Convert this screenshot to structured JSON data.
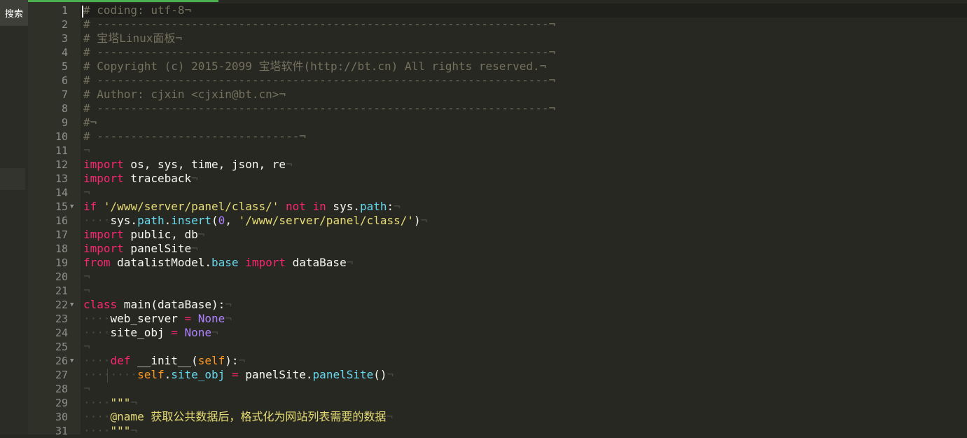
{
  "sidebar": {
    "search_label": "搜索"
  },
  "editor": {
    "lines": [
      {
        "n": "1",
        "fold": false,
        "tokens": [
          {
            "t": "# coding: utf-8¬",
            "c": "comment"
          }
        ]
      },
      {
        "n": "2",
        "fold": false,
        "tokens": [
          {
            "t": "# -------------------------------------------------------------------¬",
            "c": "comment"
          }
        ]
      },
      {
        "n": "3",
        "fold": false,
        "tokens": [
          {
            "t": "# 宝塔Linux面板¬",
            "c": "comment"
          }
        ]
      },
      {
        "n": "4",
        "fold": false,
        "tokens": [
          {
            "t": "# -------------------------------------------------------------------¬",
            "c": "comment"
          }
        ]
      },
      {
        "n": "5",
        "fold": false,
        "tokens": [
          {
            "t": "# Copyright (c) 2015-2099 宝塔软件(http://bt.cn) All rights reserved.¬",
            "c": "comment"
          }
        ]
      },
      {
        "n": "6",
        "fold": false,
        "tokens": [
          {
            "t": "# -------------------------------------------------------------------¬",
            "c": "comment"
          }
        ]
      },
      {
        "n": "7",
        "fold": false,
        "tokens": [
          {
            "t": "# Author: cjxin <cjxin@bt.cn>¬",
            "c": "comment"
          }
        ]
      },
      {
        "n": "8",
        "fold": false,
        "tokens": [
          {
            "t": "# -------------------------------------------------------------------¬",
            "c": "comment"
          }
        ]
      },
      {
        "n": "9",
        "fold": false,
        "tokens": [
          {
            "t": "#¬",
            "c": "comment"
          }
        ]
      },
      {
        "n": "10",
        "fold": false,
        "tokens": [
          {
            "t": "# ------------------------------¬",
            "c": "comment"
          }
        ]
      },
      {
        "n": "11",
        "fold": false,
        "tokens": [
          {
            "t": "¬",
            "c": "ws"
          }
        ]
      },
      {
        "n": "12",
        "fold": false,
        "tokens": [
          {
            "t": "import",
            "c": "kw"
          },
          {
            "t": " os, sys, time, json, re",
            "c": ""
          },
          {
            "t": "¬",
            "c": "ws"
          }
        ]
      },
      {
        "n": "13",
        "fold": false,
        "tokens": [
          {
            "t": "import",
            "c": "kw"
          },
          {
            "t": " traceback",
            "c": ""
          },
          {
            "t": "¬",
            "c": "ws"
          }
        ]
      },
      {
        "n": "14",
        "fold": false,
        "tokens": [
          {
            "t": "¬",
            "c": "ws"
          }
        ]
      },
      {
        "n": "15",
        "fold": true,
        "tokens": [
          {
            "t": "if",
            "c": "kw"
          },
          {
            "t": " ",
            "c": ""
          },
          {
            "t": "'/www/server/panel/class/'",
            "c": "str"
          },
          {
            "t": " ",
            "c": ""
          },
          {
            "t": "not in",
            "c": "kw"
          },
          {
            "t": " sys.",
            "c": ""
          },
          {
            "t": "path",
            "c": "attr"
          },
          {
            "t": ":",
            "c": ""
          },
          {
            "t": "¬",
            "c": "ws"
          }
        ]
      },
      {
        "n": "16",
        "fold": false,
        "tokens": [
          {
            "t": "····",
            "c": "ws"
          },
          {
            "t": "sys.",
            "c": ""
          },
          {
            "t": "path",
            "c": "attr"
          },
          {
            "t": ".",
            "c": ""
          },
          {
            "t": "insert",
            "c": "attr"
          },
          {
            "t": "(",
            "c": ""
          },
          {
            "t": "0",
            "c": "const"
          },
          {
            "t": ", ",
            "c": ""
          },
          {
            "t": "'/www/server/panel/class/'",
            "c": "str"
          },
          {
            "t": ")",
            "c": ""
          },
          {
            "t": "¬",
            "c": "ws"
          }
        ]
      },
      {
        "n": "17",
        "fold": false,
        "tokens": [
          {
            "t": "import",
            "c": "kw"
          },
          {
            "t": " public, db",
            "c": ""
          },
          {
            "t": "¬",
            "c": "ws"
          }
        ]
      },
      {
        "n": "18",
        "fold": false,
        "tokens": [
          {
            "t": "import",
            "c": "kw"
          },
          {
            "t": " panelSite",
            "c": ""
          },
          {
            "t": "¬",
            "c": "ws"
          }
        ]
      },
      {
        "n": "19",
        "fold": false,
        "tokens": [
          {
            "t": "from",
            "c": "kw"
          },
          {
            "t": " datalistModel.",
            "c": ""
          },
          {
            "t": "base",
            "c": "attr"
          },
          {
            "t": " ",
            "c": ""
          },
          {
            "t": "import",
            "c": "kw"
          },
          {
            "t": " dataBase",
            "c": ""
          },
          {
            "t": "¬",
            "c": "ws"
          }
        ]
      },
      {
        "n": "20",
        "fold": false,
        "tokens": [
          {
            "t": "¬",
            "c": "ws"
          }
        ]
      },
      {
        "n": "21",
        "fold": false,
        "tokens": [
          {
            "t": "¬",
            "c": "ws"
          }
        ]
      },
      {
        "n": "22",
        "fold": true,
        "tokens": [
          {
            "t": "class",
            "c": "kw"
          },
          {
            "t": " main(dataBase):",
            "c": ""
          },
          {
            "t": "¬",
            "c": "ws"
          }
        ]
      },
      {
        "n": "23",
        "fold": false,
        "tokens": [
          {
            "t": "····",
            "c": "ws"
          },
          {
            "t": "web_server ",
            "c": ""
          },
          {
            "t": "=",
            "c": "kw"
          },
          {
            "t": " ",
            "c": ""
          },
          {
            "t": "None",
            "c": "const"
          },
          {
            "t": "¬",
            "c": "ws"
          }
        ]
      },
      {
        "n": "24",
        "fold": false,
        "tokens": [
          {
            "t": "····",
            "c": "ws"
          },
          {
            "t": "site_obj ",
            "c": ""
          },
          {
            "t": "=",
            "c": "kw"
          },
          {
            "t": " ",
            "c": ""
          },
          {
            "t": "None",
            "c": "const"
          },
          {
            "t": "¬",
            "c": "ws"
          }
        ]
      },
      {
        "n": "25",
        "fold": false,
        "tokens": [
          {
            "t": "¬",
            "c": "ws"
          }
        ]
      },
      {
        "n": "26",
        "fold": true,
        "tokens": [
          {
            "t": "····",
            "c": "ws"
          },
          {
            "t": "def",
            "c": "kw"
          },
          {
            "t": " __init__(",
            "c": ""
          },
          {
            "t": "self",
            "c": "self"
          },
          {
            "t": "):",
            "c": ""
          },
          {
            "t": "¬",
            "c": "ws"
          }
        ]
      },
      {
        "n": "27",
        "fold": false,
        "tokens": [
          {
            "t": "········",
            "c": "ws"
          },
          {
            "t": "self",
            "c": "self"
          },
          {
            "t": ".",
            "c": ""
          },
          {
            "t": "site_obj",
            "c": "attr"
          },
          {
            "t": " ",
            "c": ""
          },
          {
            "t": "=",
            "c": "kw"
          },
          {
            "t": " panelSite.",
            "c": ""
          },
          {
            "t": "panelSite",
            "c": "attr"
          },
          {
            "t": "()",
            "c": ""
          },
          {
            "t": "¬",
            "c": "ws"
          }
        ]
      },
      {
        "n": "28",
        "fold": false,
        "tokens": [
          {
            "t": "¬",
            "c": "ws"
          }
        ]
      },
      {
        "n": "29",
        "fold": false,
        "tokens": [
          {
            "t": "····",
            "c": "ws"
          },
          {
            "t": "\"\"\"",
            "c": "str"
          },
          {
            "t": "¬",
            "c": "ws"
          }
        ]
      },
      {
        "n": "30",
        "fold": false,
        "tokens": [
          {
            "t": "····",
            "c": "ws"
          },
          {
            "t": "@name 获取公共数据后，格式化为网站列表需要的数据",
            "c": "str"
          },
          {
            "t": "¬",
            "c": "ws"
          }
        ]
      },
      {
        "n": "31",
        "fold": false,
        "tokens": [
          {
            "t": "····",
            "c": "ws"
          },
          {
            "t": "\"\"\"",
            "c": "str"
          },
          {
            "t": "¬",
            "c": "ws"
          }
        ]
      }
    ]
  },
  "colors": {
    "background": "#272822",
    "gutter": "#2f3129",
    "accent": "#4caf50",
    "keyword": "#f92672",
    "string": "#e6db74",
    "comment": "#75715e",
    "attribute": "#66d9ef",
    "constant": "#ae81ff"
  },
  "icons": {
    "collapse": "chevron-left-icon",
    "fold": "fold-arrow-icon"
  }
}
